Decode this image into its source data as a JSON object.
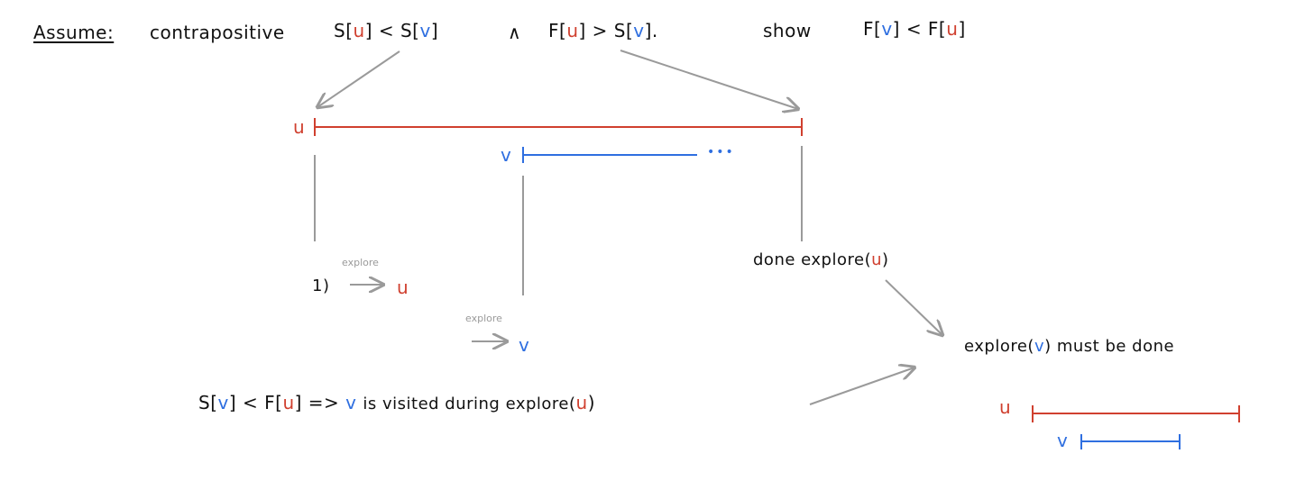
{
  "header": {
    "assume_label": "Assume:",
    "contrapositive_label": "contrapositive",
    "premise_1": {
      "s": "S[",
      "u": "u",
      "mid": "] < S[",
      "v": "v",
      "end": "]"
    },
    "and_symbol": "∧",
    "premise_2": {
      "f": "F[",
      "u": "u",
      "mid": "] > S[",
      "v": "v",
      "end": "]."
    },
    "show_label": "show",
    "goal": {
      "f": "F[",
      "v": "v",
      "mid": "] < F[",
      "u": "u",
      "end": "]"
    }
  },
  "timeline_top": {
    "u_label": "u",
    "v_label": "v",
    "ellipsis": "•••"
  },
  "steps": {
    "step1_number": "1)",
    "step1_caption": "explore",
    "step1_target": "u",
    "step2_caption": "explore",
    "step2_target": "v",
    "done_text": "done explore(",
    "done_u": "u",
    "done_close": ")"
  },
  "conclusion": {
    "s_open": "S[",
    "v1": "v",
    "mid": "] < F[",
    "u1": "u",
    "implies": "] =>",
    "v2": "v",
    "rest": "is visited during explore(",
    "u2": "u",
    "close": ")"
  },
  "result": {
    "text_open": "explore(",
    "v": "v",
    "text_close": ") must be done",
    "u_label": "u",
    "v_label": "v"
  },
  "colors": {
    "u": "#d0402f",
    "v": "#2f6fe0",
    "arrow": "#9a9a9a"
  }
}
